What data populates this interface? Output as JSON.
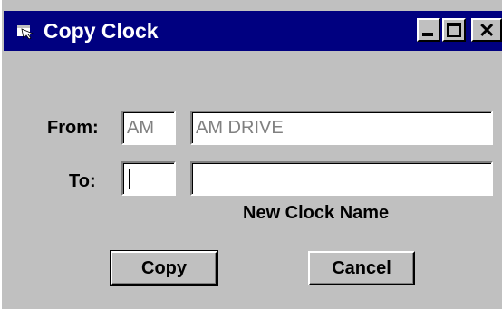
{
  "window": {
    "title": "Copy Clock",
    "minimize_icon": "minimize-icon",
    "maximize_icon": "maximize-icon",
    "close_icon": "close-icon"
  },
  "form": {
    "from_label": "From:",
    "from_code": "AM",
    "from_name": "AM DRIVE",
    "to_label": "To:",
    "to_code": "",
    "to_name": "",
    "new_clock_name_label": "New Clock Name"
  },
  "buttons": {
    "copy_label": "Copy",
    "cancel_label": "Cancel"
  },
  "colors": {
    "titlebar": "#000080",
    "face": "#c0c0c0",
    "disabled_text": "#808080"
  }
}
